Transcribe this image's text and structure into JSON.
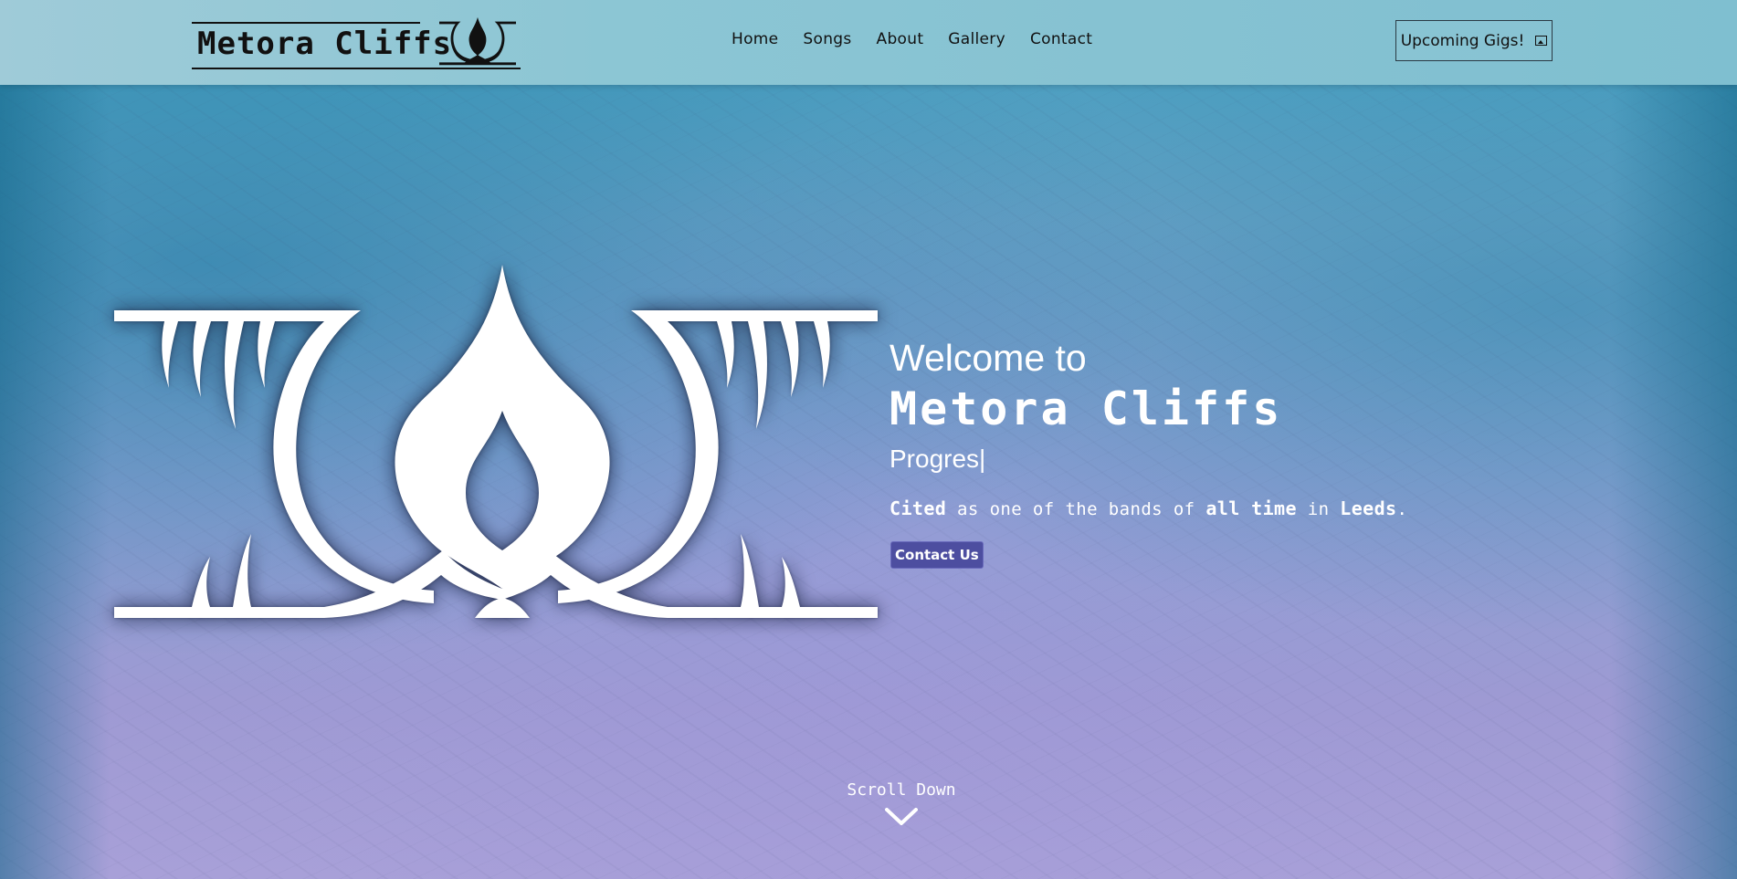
{
  "header": {
    "brand": "Metora Cliffs",
    "nav": [
      "Home",
      "Songs",
      "About",
      "Gallery",
      "Contact"
    ],
    "gigs_button": "Upcoming Gigs!",
    "gigs_icon": "external-link-icon"
  },
  "hero": {
    "welcome": "Welcome to",
    "band_name": "Metora Cliffs",
    "typed_text": "Progres",
    "cursor": "|",
    "tagline": {
      "w1": "Cited",
      "t1": " as one of the bands of ",
      "w2": "all time",
      "t2": " in ",
      "w3": "Leeds",
      "t3": "."
    },
    "contact_button": "Contact Us"
  },
  "scroll": {
    "label": "Scroll Down",
    "icon": "chevron-down-icon"
  },
  "colors": {
    "accent_button": "#4d4ea0",
    "navbar": "#8cc6d4",
    "text_light": "#ffffff",
    "text_dark": "#111111"
  }
}
